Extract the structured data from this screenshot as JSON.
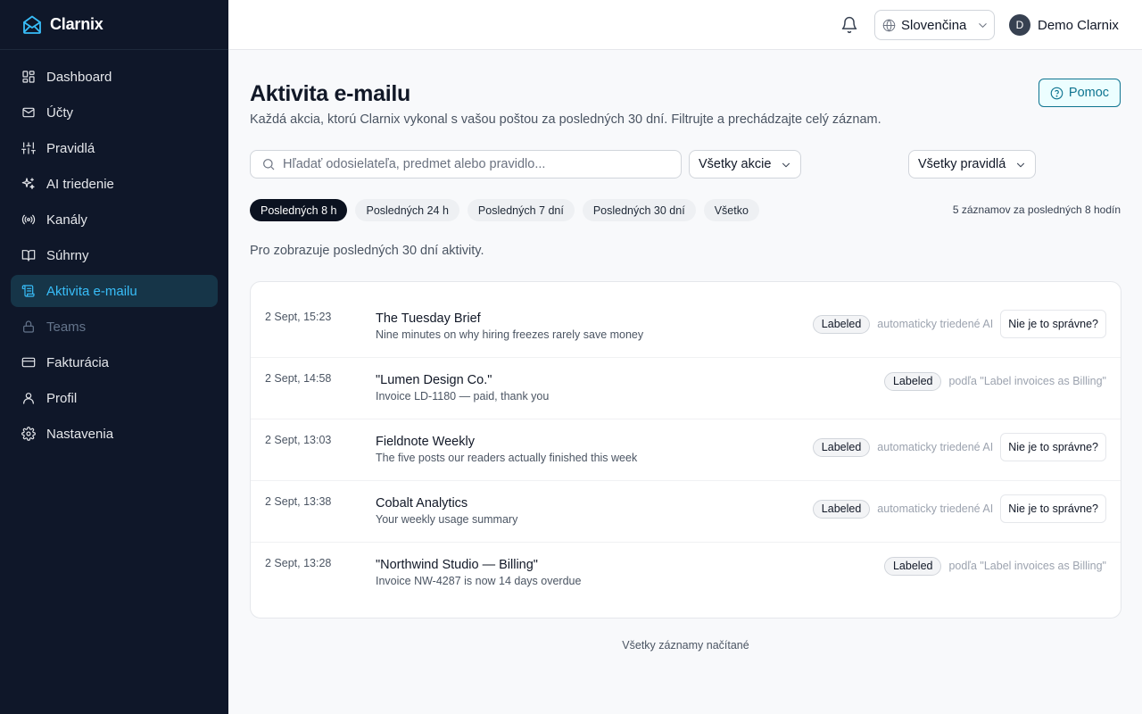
{
  "brand": {
    "name": "Clarnix"
  },
  "sidebar": {
    "items": [
      {
        "label": "Dashboard",
        "icon": "dashboard-icon"
      },
      {
        "label": "Účty",
        "icon": "mail-icon"
      },
      {
        "label": "Pravidlá",
        "icon": "sliders-icon"
      },
      {
        "label": "AI triedenie",
        "icon": "sparkles-icon"
      },
      {
        "label": "Kanály",
        "icon": "radio-icon"
      },
      {
        "label": "Súhrny",
        "icon": "book-icon"
      },
      {
        "label": "Aktivita e-mailu",
        "icon": "activity-scroll-icon",
        "active": true
      },
      {
        "label": "Teams",
        "icon": "lock-icon",
        "disabled": true
      },
      {
        "label": "Fakturácia",
        "icon": "credit-card-icon"
      },
      {
        "label": "Profil",
        "icon": "user-icon"
      },
      {
        "label": "Nastavenia",
        "icon": "gear-icon"
      }
    ]
  },
  "topbar": {
    "language": "Slovenčina",
    "user_initial": "D",
    "user_name": "Demo Clarnix"
  },
  "page": {
    "title": "Aktivita e-mailu",
    "subtitle": "Každá akcia, ktorú Clarnix vykonal s vašou poštou za posledných 30 dní. Filtrujte a prechádzajte celý záznam.",
    "help_label": "Pomoc",
    "search_placeholder": "Hľadať odosielateľa, predmet alebo pravidlo...",
    "actions_filter": "Všetky akcie",
    "rules_filter": "Všetky pravidlá",
    "time_chips": [
      "Posledných 8 h",
      "Posledných 24 h",
      "Posledných 7 dní",
      "Posledných 30 dní",
      "Všetko"
    ],
    "active_chip": 0,
    "count_text": "5 záznamov za posledných 8 hodín",
    "pro_note": "Pro zobrazuje posledných 30 dní aktivity.",
    "footer_note": "Všetky záznamy načítané"
  },
  "entries": [
    {
      "time": "2 Sept, 15:23",
      "sender": "The Tuesday Brief",
      "subject": "Nine minutes on why hiring freezes rarely save money",
      "badge": "Labeled",
      "reason": "automaticky triedené AI",
      "wrong_label": "Nie je to správne?"
    },
    {
      "time": "2 Sept, 14:58",
      "sender": "\"Lumen Design Co.\"",
      "subject": "Invoice LD-1180 — paid, thank you",
      "badge": "Labeled",
      "reason": "podľa \"Label invoices as Billing\"",
      "wrong_label": ""
    },
    {
      "time": "2 Sept, 13:03",
      "sender": "Fieldnote Weekly",
      "subject": "The five posts our readers actually finished this week",
      "badge": "Labeled",
      "reason": "automaticky triedené AI",
      "wrong_label": "Nie je to správne?"
    },
    {
      "time": "2 Sept, 13:38",
      "sender": "Cobalt Analytics",
      "subject": "Your weekly usage summary",
      "badge": "Labeled",
      "reason": "automaticky triedené AI",
      "wrong_label": "Nie je to správne?"
    },
    {
      "time": "2 Sept, 13:28",
      "sender": "\"Northwind Studio — Billing\"",
      "subject": "Invoice NW-4287 is now 14 days overdue",
      "badge": "Labeled",
      "reason": "podľa \"Label invoices as Billing\"",
      "wrong_label": ""
    }
  ],
  "colors": {
    "sidebar_bg": "#0f1729",
    "accent": "#38bdf8",
    "help": "#0e7490"
  }
}
